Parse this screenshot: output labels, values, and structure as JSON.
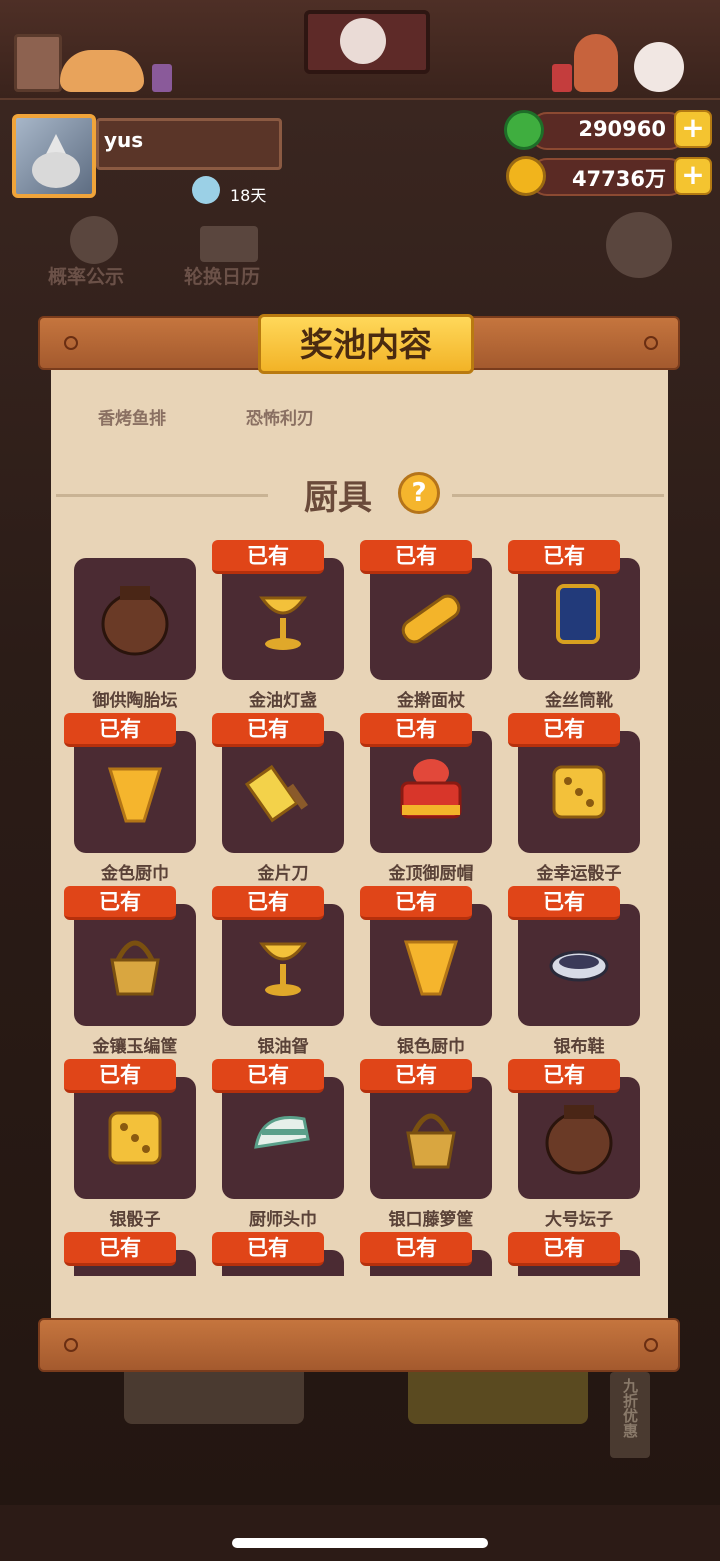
{
  "header": {
    "username": "yus",
    "days": "18天"
  },
  "resources": {
    "jade_value": "290960",
    "coin_value": "47736万",
    "plus_label": "+"
  },
  "background_buttons": {
    "probability": "概率公示",
    "calendar": "轮换日历",
    "discount": "九折优惠"
  },
  "panel": {
    "title": "奖池内容",
    "prev_items": [
      "香烤鱼排",
      "恐怖利刃"
    ],
    "section_title": "厨具",
    "help_label": "?",
    "owned_label": "已有",
    "items": [
      {
        "name": "御供陶胎坛",
        "owned": false,
        "icon": "jar-icon"
      },
      {
        "name": "金油灯盏",
        "owned": true,
        "icon": "goblet-icon"
      },
      {
        "name": "金擀面杖",
        "owned": true,
        "icon": "rolling-pin-icon"
      },
      {
        "name": "金丝筒靴",
        "owned": true,
        "icon": "boot-icon"
      },
      {
        "name": "金色厨巾",
        "owned": true,
        "icon": "scarf-icon"
      },
      {
        "name": "金片刀",
        "owned": true,
        "icon": "cleaver-icon"
      },
      {
        "name": "金顶御厨帽",
        "owned": true,
        "icon": "chef-hat-icon"
      },
      {
        "name": "金幸运骰子",
        "owned": true,
        "icon": "dice-icon"
      },
      {
        "name": "金镶玉编筐",
        "owned": true,
        "icon": "basket-icon"
      },
      {
        "name": "银油眢",
        "owned": true,
        "icon": "goblet-icon"
      },
      {
        "name": "银色厨巾",
        "owned": true,
        "icon": "scarf-icon"
      },
      {
        "name": "银布鞋",
        "owned": true,
        "icon": "shoe-icon"
      },
      {
        "name": "银骰子",
        "owned": true,
        "icon": "dice-icon"
      },
      {
        "name": "厨师头巾",
        "owned": true,
        "icon": "headscarf-icon"
      },
      {
        "name": "银口藤箩筐",
        "owned": true,
        "icon": "basket-icon"
      },
      {
        "name": "大号坛子",
        "owned": true,
        "icon": "jar-icon"
      },
      {
        "name": "",
        "owned": true,
        "icon": "unknown-icon"
      },
      {
        "name": "",
        "owned": true,
        "icon": "unknown-icon"
      },
      {
        "name": "",
        "owned": true,
        "icon": "unknown-icon"
      },
      {
        "name": "",
        "owned": true,
        "icon": "unknown-icon"
      }
    ]
  },
  "colors": {
    "badge": "#e04518",
    "tile": "#4b2b33",
    "panel": "#e8d4b7",
    "title_board": "#f2b327"
  }
}
